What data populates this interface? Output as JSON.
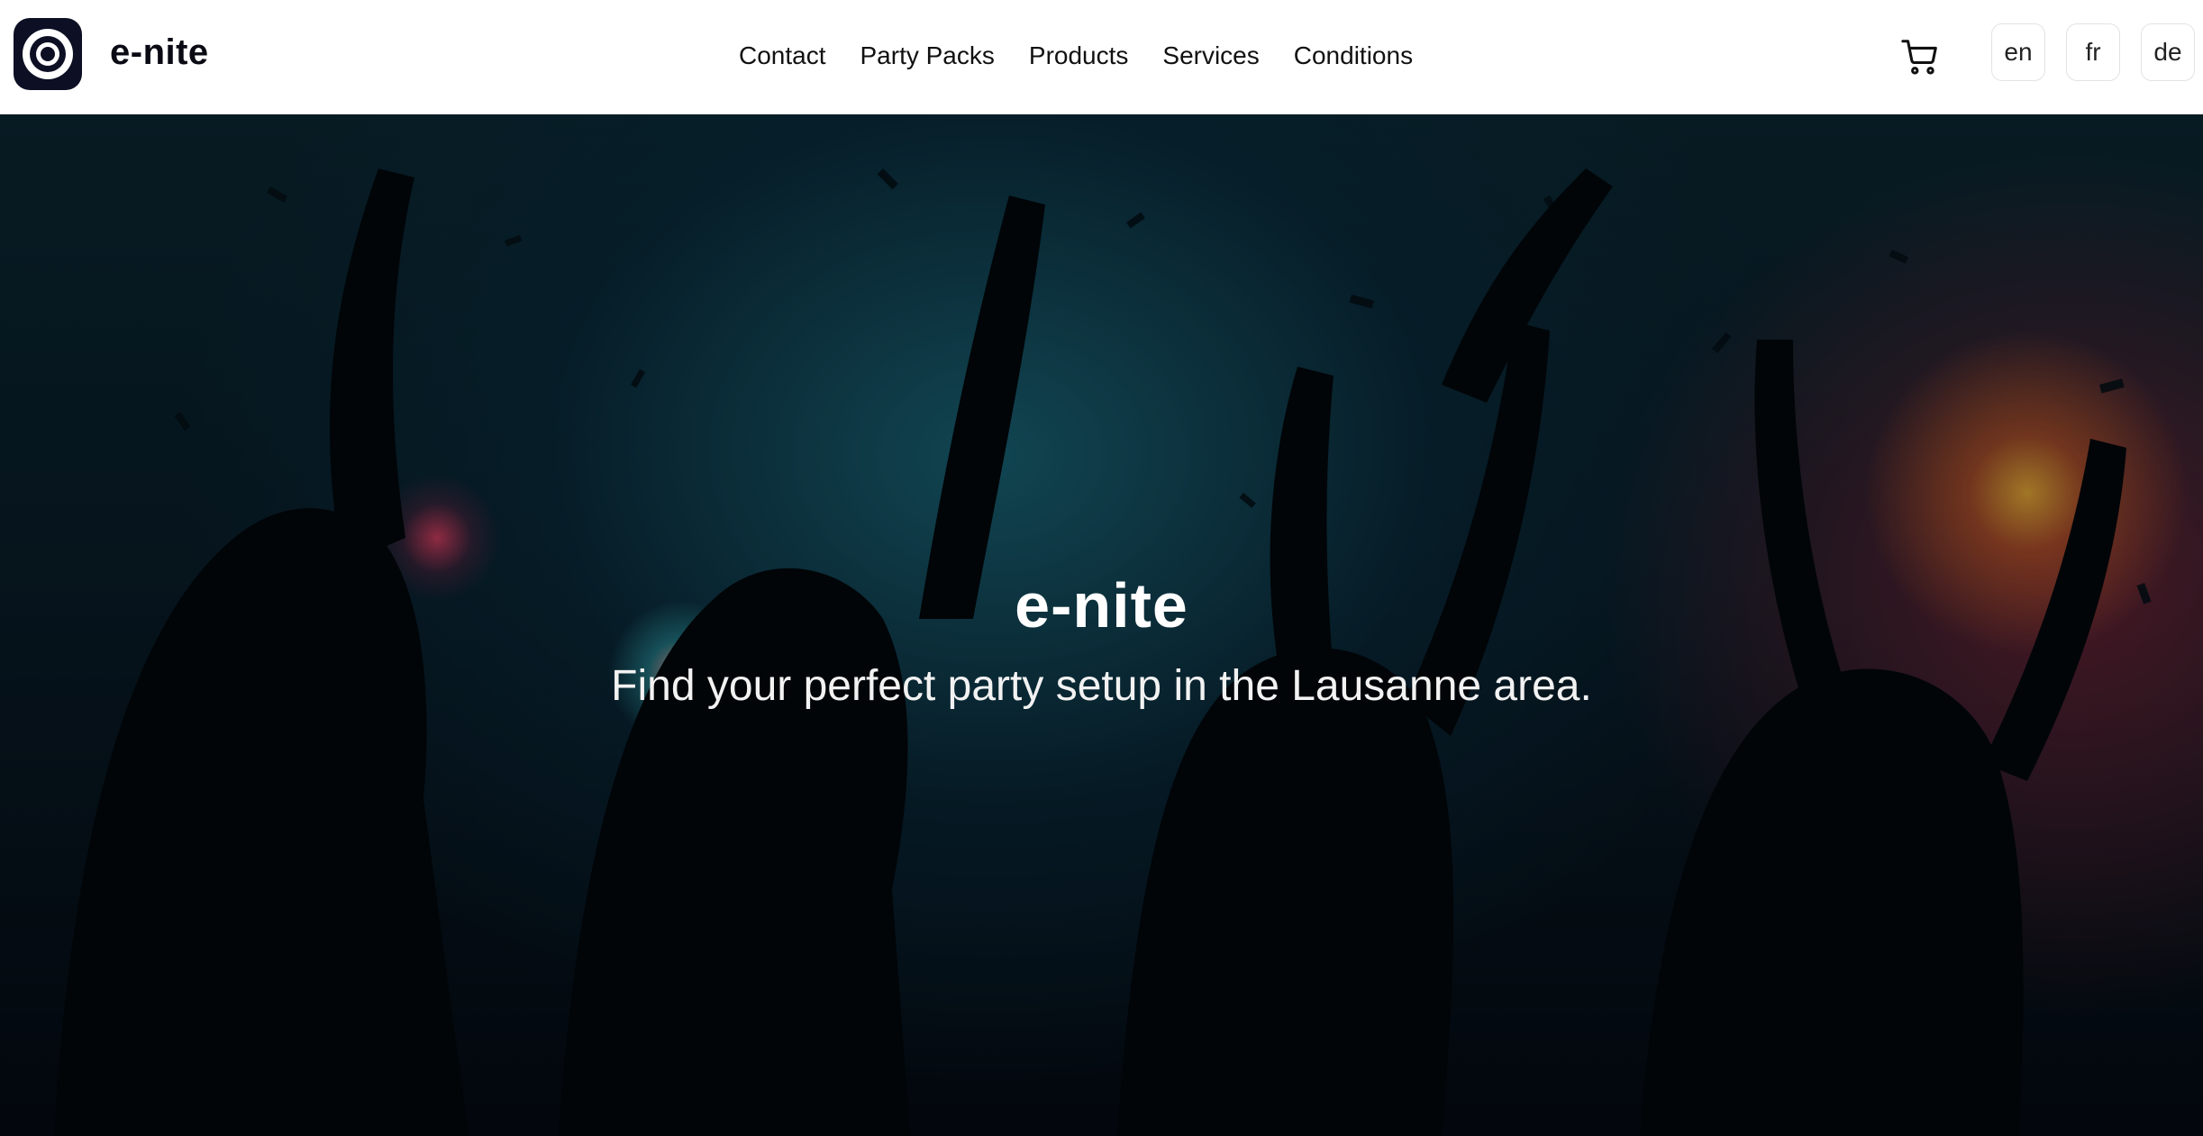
{
  "header": {
    "brand": "e-nite",
    "logo_icon": "target-ring-icon",
    "nav": [
      "Contact",
      "Party Packs",
      "Products",
      "Services",
      "Conditions"
    ],
    "cart_icon": "shopping-cart-icon",
    "languages": [
      "en",
      "fr",
      "de"
    ]
  },
  "hero": {
    "title": "e-nite",
    "subtitle": "Find your perfect party setup in the Lausanne area."
  }
}
